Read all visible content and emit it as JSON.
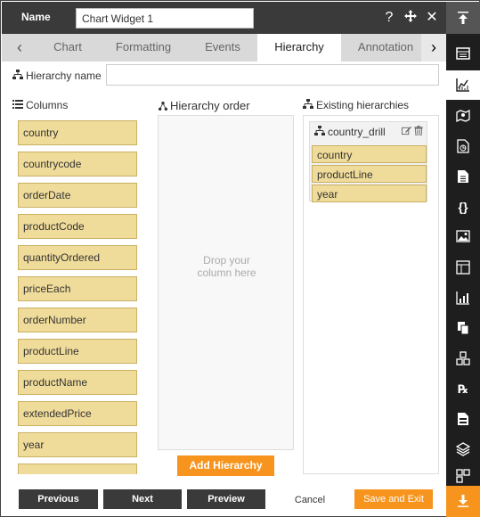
{
  "header": {
    "name_label": "Name",
    "name_value": "Chart Widget 1",
    "icons": [
      "help-icon",
      "move-icon",
      "close-icon"
    ]
  },
  "tabs": {
    "items": [
      {
        "label": "Chart"
      },
      {
        "label": "Formatting"
      },
      {
        "label": "Events"
      },
      {
        "label": "Hierarchy",
        "active": true
      },
      {
        "label": "Annotation"
      }
    ]
  },
  "hierarchy_name": {
    "label": "Hierarchy name",
    "value": ""
  },
  "columns": {
    "title": "Columns",
    "items": [
      "country",
      "countrycode",
      "orderDate",
      "productCode",
      "quantityOrdered",
      "priceEach",
      "orderNumber",
      "productLine",
      "productName",
      "extendedPrice",
      "year"
    ]
  },
  "hierarchy_order": {
    "title": "Hierarchy order",
    "drop_line1": "Drop your",
    "drop_line2": "column here",
    "add_button": "Add Hierarchy"
  },
  "existing": {
    "title": "Existing hierarchies",
    "hierarchies": [
      {
        "name": "country_drill",
        "levels": [
          "country",
          "productLine",
          "year"
        ]
      }
    ]
  },
  "footer": {
    "previous": "Previous",
    "next": "Next",
    "preview": "Preview",
    "cancel": "Cancel",
    "save_exit": "Save and Exit"
  },
  "colors": {
    "accent": "#f7941d",
    "header_bg": "#3a3a3a",
    "item_bg": "#f0dc9a",
    "item_border": "#c9b061"
  },
  "sidebar_icons": [
    "scroll-top-icon",
    "datasource-icon",
    "chart-icon",
    "map-icon",
    "report-icon",
    "document-icon",
    "code-icon",
    "image-icon",
    "table-icon",
    "kpi-chart-icon",
    "copy-icon",
    "cluster-icon",
    "formula-icon",
    "form-icon",
    "layers-icon",
    "grid-icon",
    "scroll-bottom-icon"
  ]
}
